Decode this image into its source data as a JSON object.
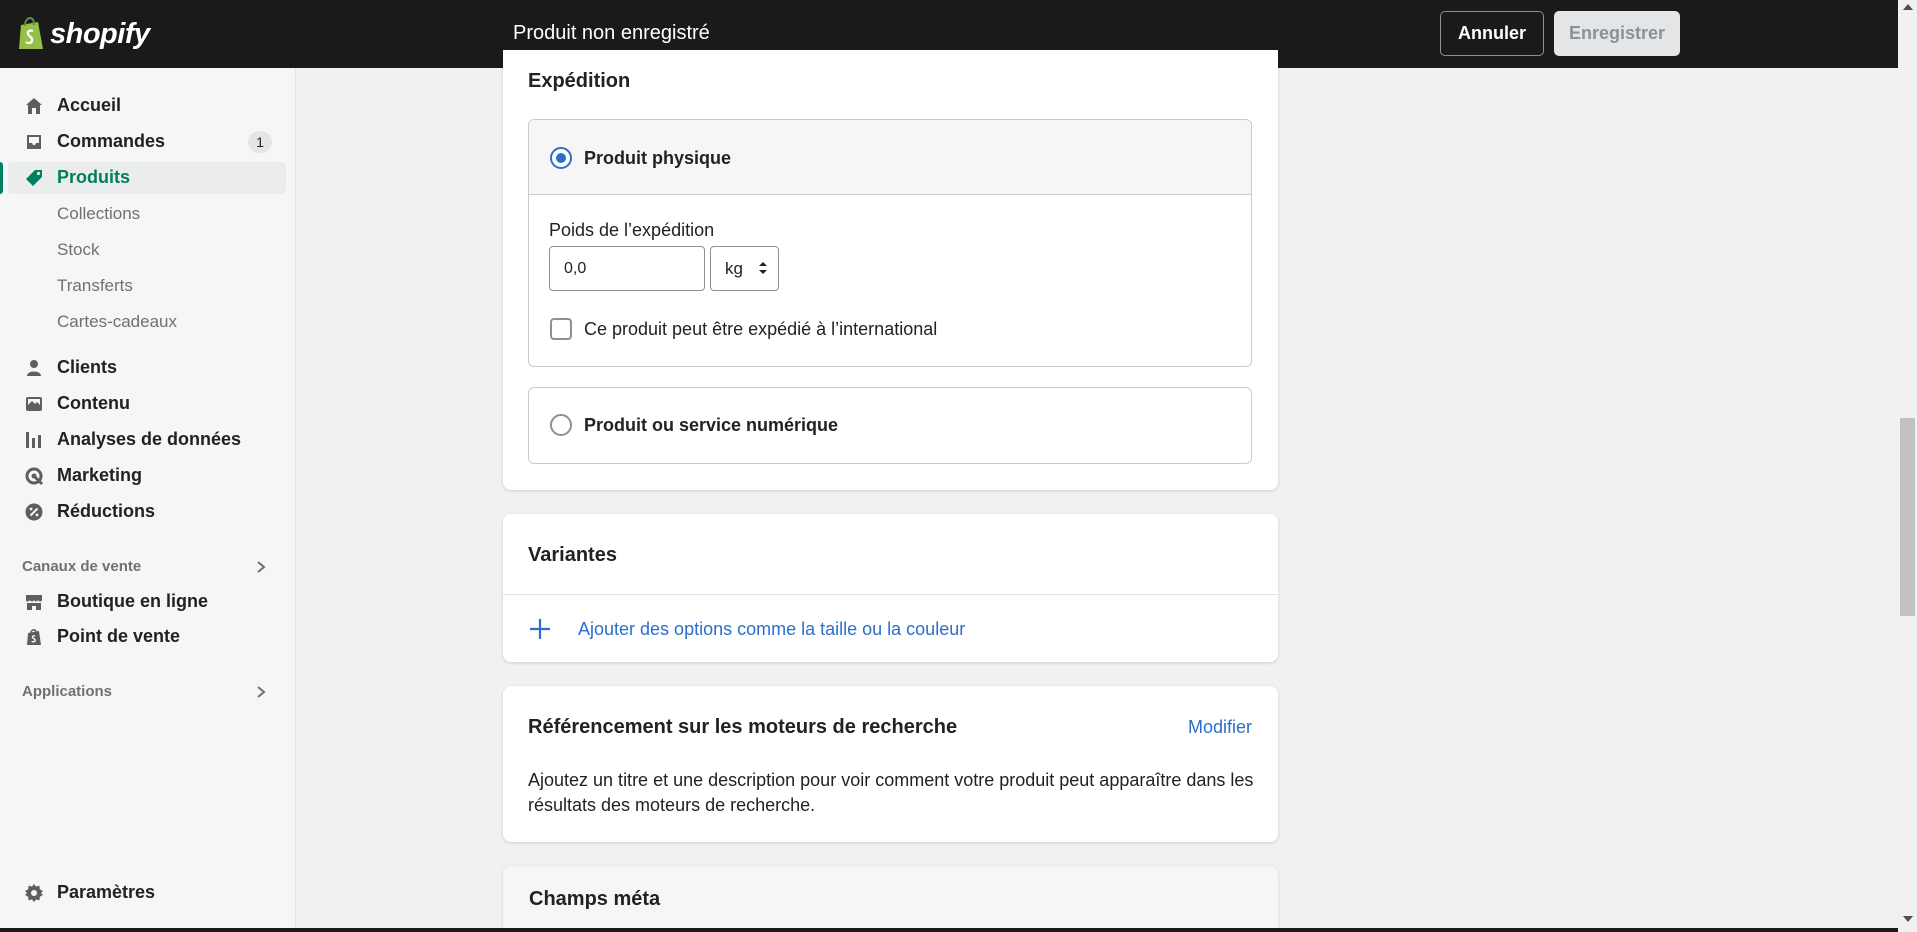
{
  "header": {
    "brand": "shopify",
    "status": "Produit non enregistré",
    "cancel_label": "Annuler",
    "save_label": "Enregistrer"
  },
  "sidebar": {
    "items": [
      {
        "label": "Accueil",
        "icon": "home-icon"
      },
      {
        "label": "Commandes",
        "icon": "inbox-icon",
        "badge": "1"
      },
      {
        "label": "Produits",
        "icon": "tag-icon",
        "active": true
      },
      {
        "label": "Clients",
        "icon": "person-icon"
      },
      {
        "label": "Contenu",
        "icon": "content-icon"
      },
      {
        "label": "Analyses de données",
        "icon": "analytics-icon"
      },
      {
        "label": "Marketing",
        "icon": "marketing-icon"
      },
      {
        "label": "Réductions",
        "icon": "discount-icon"
      }
    ],
    "subitems": [
      "Collections",
      "Stock",
      "Transferts",
      "Cartes-cadeaux"
    ],
    "sales_channels": {
      "heading": "Canaux de vente",
      "items": [
        {
          "label": "Boutique en ligne",
          "icon": "store-icon"
        },
        {
          "label": "Point de vente",
          "icon": "pos-icon"
        }
      ]
    },
    "apps_heading": "Applications",
    "settings_label": "Paramètres"
  },
  "shipping": {
    "title": "Expédition",
    "physical_label": "Produit physique",
    "weight_label": "Poids de l’expédition",
    "weight_value": "0,0",
    "unit": "kg",
    "international_label": "Ce produit peut être expédié à l’international",
    "digital_label": "Produit ou service numérique"
  },
  "variants": {
    "title": "Variantes",
    "add_options_label": "Ajouter des options comme la taille ou la couleur"
  },
  "seo": {
    "title": "Référencement sur les moteurs de recherche",
    "edit_label": "Modifier",
    "description_line1": "Ajoutez un titre et une description pour voir comment votre produit peut apparaître dans les",
    "description_line2": "résultats des moteurs de recherche."
  },
  "metafields": {
    "title": "Champs méta"
  },
  "colors": {
    "accent": "#2c6ecb",
    "active_nav": "#007f5f",
    "topbar": "#1a1a1a"
  }
}
